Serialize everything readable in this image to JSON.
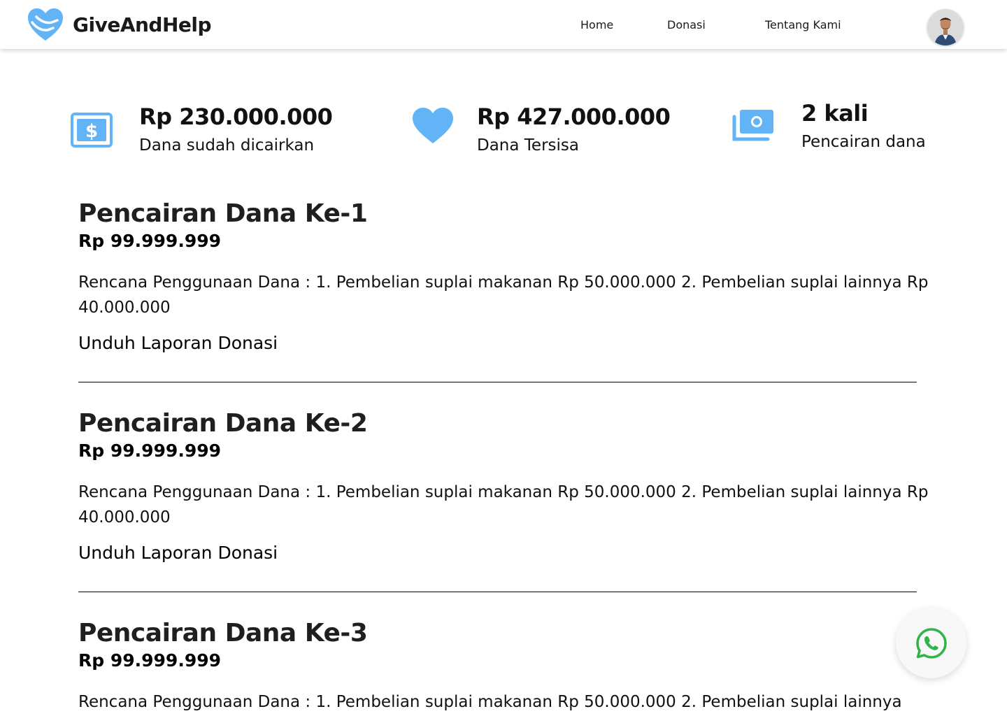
{
  "header": {
    "brand_name": "GiveAndHelp",
    "nav": [
      "Home",
      "Donasi",
      "Tentang Kami"
    ]
  },
  "stats": [
    {
      "value": "Rp 230.000.000",
      "label": "Dana sudah dicairkan",
      "icon": "dollar-bill-icon"
    },
    {
      "value": "Rp 427.000.000",
      "label": "Dana Tersisa",
      "icon": "heart-icon"
    },
    {
      "value": "2 kali",
      "label": "Pencairan dana",
      "icon": "money-stack-icon"
    }
  ],
  "entries": [
    {
      "title": "Pencairan Dana Ke-1",
      "amount": "Rp 99.999.999",
      "plan": "Rencana Penggunaan Dana : 1. Pembelian suplai makanan Rp 50.000.000 2. Pembelian suplai lainnya Rp 40.000.000",
      "link": "Unduh Laporan Donasi"
    },
    {
      "title": "Pencairan Dana Ke-2",
      "amount": "Rp 99.999.999",
      "plan": "Rencana Penggunaan Dana : 1. Pembelian suplai makanan Rp 50.000.000 2. Pembelian suplai lainnya Rp 40.000.000",
      "link": "Unduh Laporan Donasi"
    },
    {
      "title": "Pencairan Dana Ke-3",
      "amount": "Rp 99.999.999",
      "plan": "Rencana Penggunaan Dana : 1. Pembelian suplai makanan Rp 50.000.000 2. Pembelian suplai lainnya",
      "link": ""
    }
  ],
  "colors": {
    "accent": "#62b4f7",
    "whatsapp": "#2fb44a"
  }
}
